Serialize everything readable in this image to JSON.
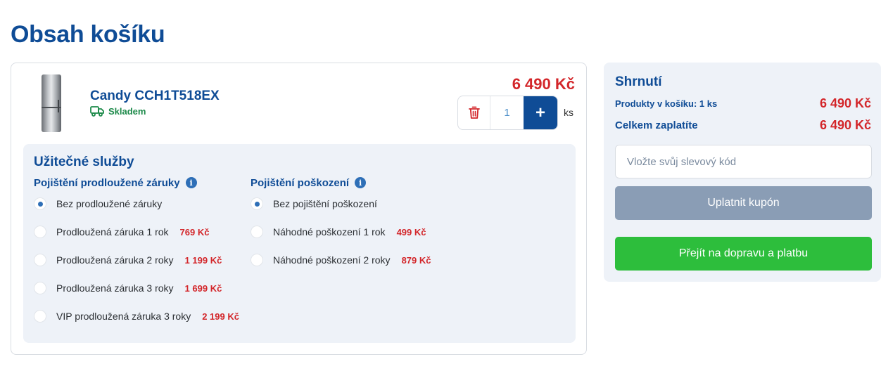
{
  "page": {
    "title": "Obsah košíku"
  },
  "product": {
    "name": "Candy CCH1T518EX",
    "stock": "Skladem",
    "price": "6 490 Kč",
    "quantity": "1",
    "unit": "ks",
    "plus_label": "+"
  },
  "services": {
    "title": "Užitečné služby",
    "warranty": {
      "heading": "Pojištění prodloužené záruky",
      "options": [
        {
          "label": "Bez prodloužené záruky",
          "price": "",
          "selected": true
        },
        {
          "label": "Prodloužená záruka 1 rok",
          "price": "769 Kč",
          "selected": false
        },
        {
          "label": "Prodloužená záruka 2 roky",
          "price": "1 199 Kč",
          "selected": false
        },
        {
          "label": "Prodloužená záruka 3 roky",
          "price": "1 699 Kč",
          "selected": false
        },
        {
          "label": "VIP prodloužená záruka 3 roky",
          "price": "2 199 Kč",
          "selected": false
        }
      ]
    },
    "damage": {
      "heading": "Pojištění poškození",
      "options": [
        {
          "label": "Bez pojištění poškození",
          "price": "",
          "selected": true
        },
        {
          "label": "Náhodné poškození 1 rok",
          "price": "499 Kč",
          "selected": false
        },
        {
          "label": "Náhodné poškození 2 roky",
          "price": "879 Kč",
          "selected": false
        }
      ]
    }
  },
  "summary": {
    "title": "Shrnutí",
    "products_label": "Produkty v košíku: 1 ks",
    "products_value": "6 490 Kč",
    "total_label": "Celkem zaplatíte",
    "total_value": "6 490 Kč",
    "coupon_placeholder": "Vložte svůj slevový kód",
    "coupon_button": "Uplatnit kupón",
    "checkout_button": "Přejít na dopravu a platbu"
  },
  "colors": {
    "brand": "#0f4c96",
    "price": "#d3262a",
    "stock": "#1d8a4a",
    "checkout": "#2dbe3c",
    "coupon_btn": "#8a9db5"
  }
}
